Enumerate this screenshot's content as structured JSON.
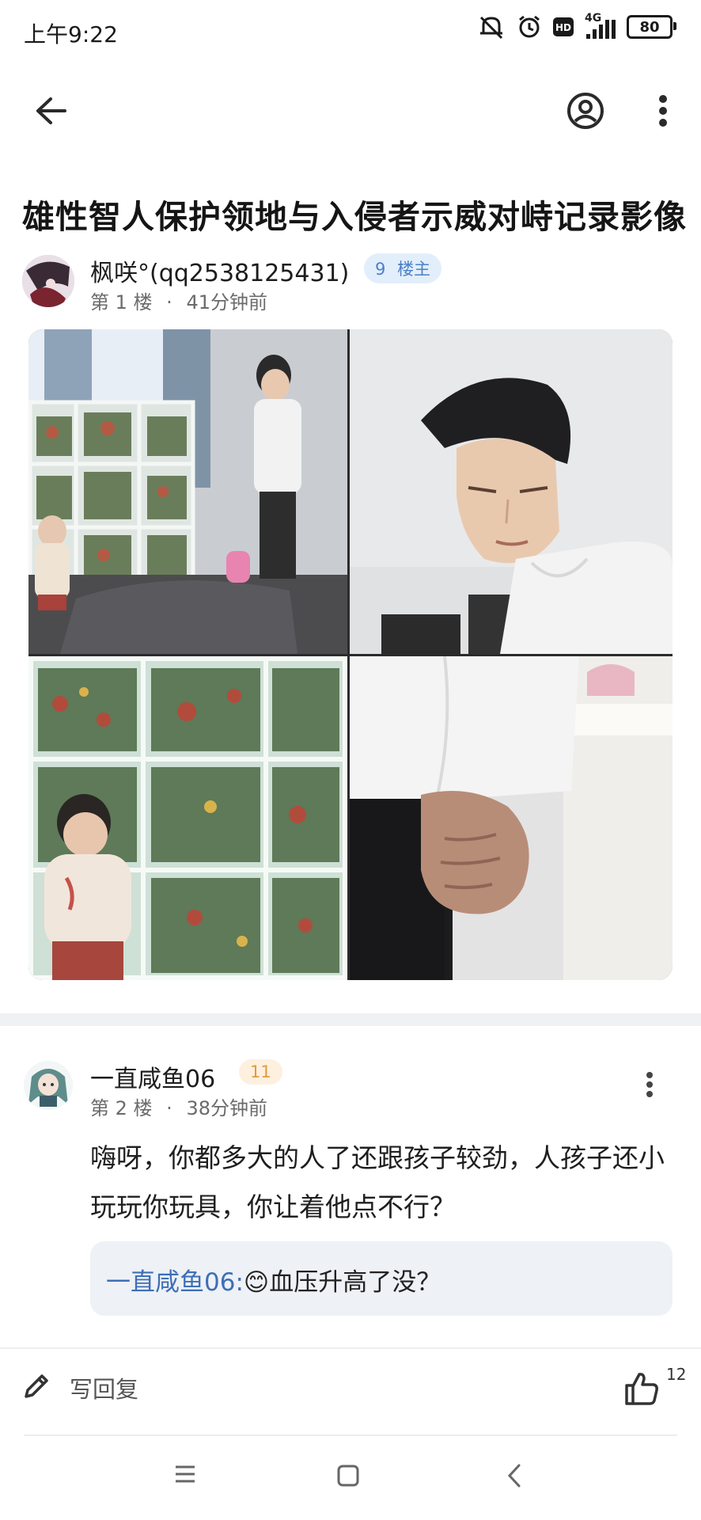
{
  "status_bar": {
    "time": "上午9:22",
    "network": "4G",
    "battery": "80",
    "icons": [
      "mute-icon",
      "alarm-icon",
      "hd-icon",
      "signal-icon",
      "battery-icon"
    ]
  },
  "topbar": {
    "icons": [
      "back-arrow-icon",
      "profile-icon",
      "more-vertical-icon"
    ]
  },
  "post": {
    "title": "雄性智人保护领地与入侵者示威对峙记录影像",
    "author": "枫咲°(qq2538125431)",
    "level": "9",
    "role": "楼主",
    "floor": "第 1 楼",
    "time": "41分钟前"
  },
  "reply": {
    "author": "一直咸鱼06",
    "level": "11",
    "floor": "第 2 楼",
    "time": "38分钟前",
    "text": "嗨呀，你都多大的人了还跟孩子较劲，人孩子还小玩玩你玩具，你让着他点不行？",
    "quote_author": "一直咸鱼06:",
    "quote_emoji": "😊",
    "quote_text": "血压升高了没？"
  },
  "bottom_bar": {
    "reply_label": "写回复",
    "like_count": "12"
  },
  "colors": {
    "accent_blue": "#3d6fb7",
    "badge_blue_bg": "#e3eefb",
    "badge_orange_bg": "#fdf0df",
    "badge_orange_text": "#e39a3a"
  }
}
